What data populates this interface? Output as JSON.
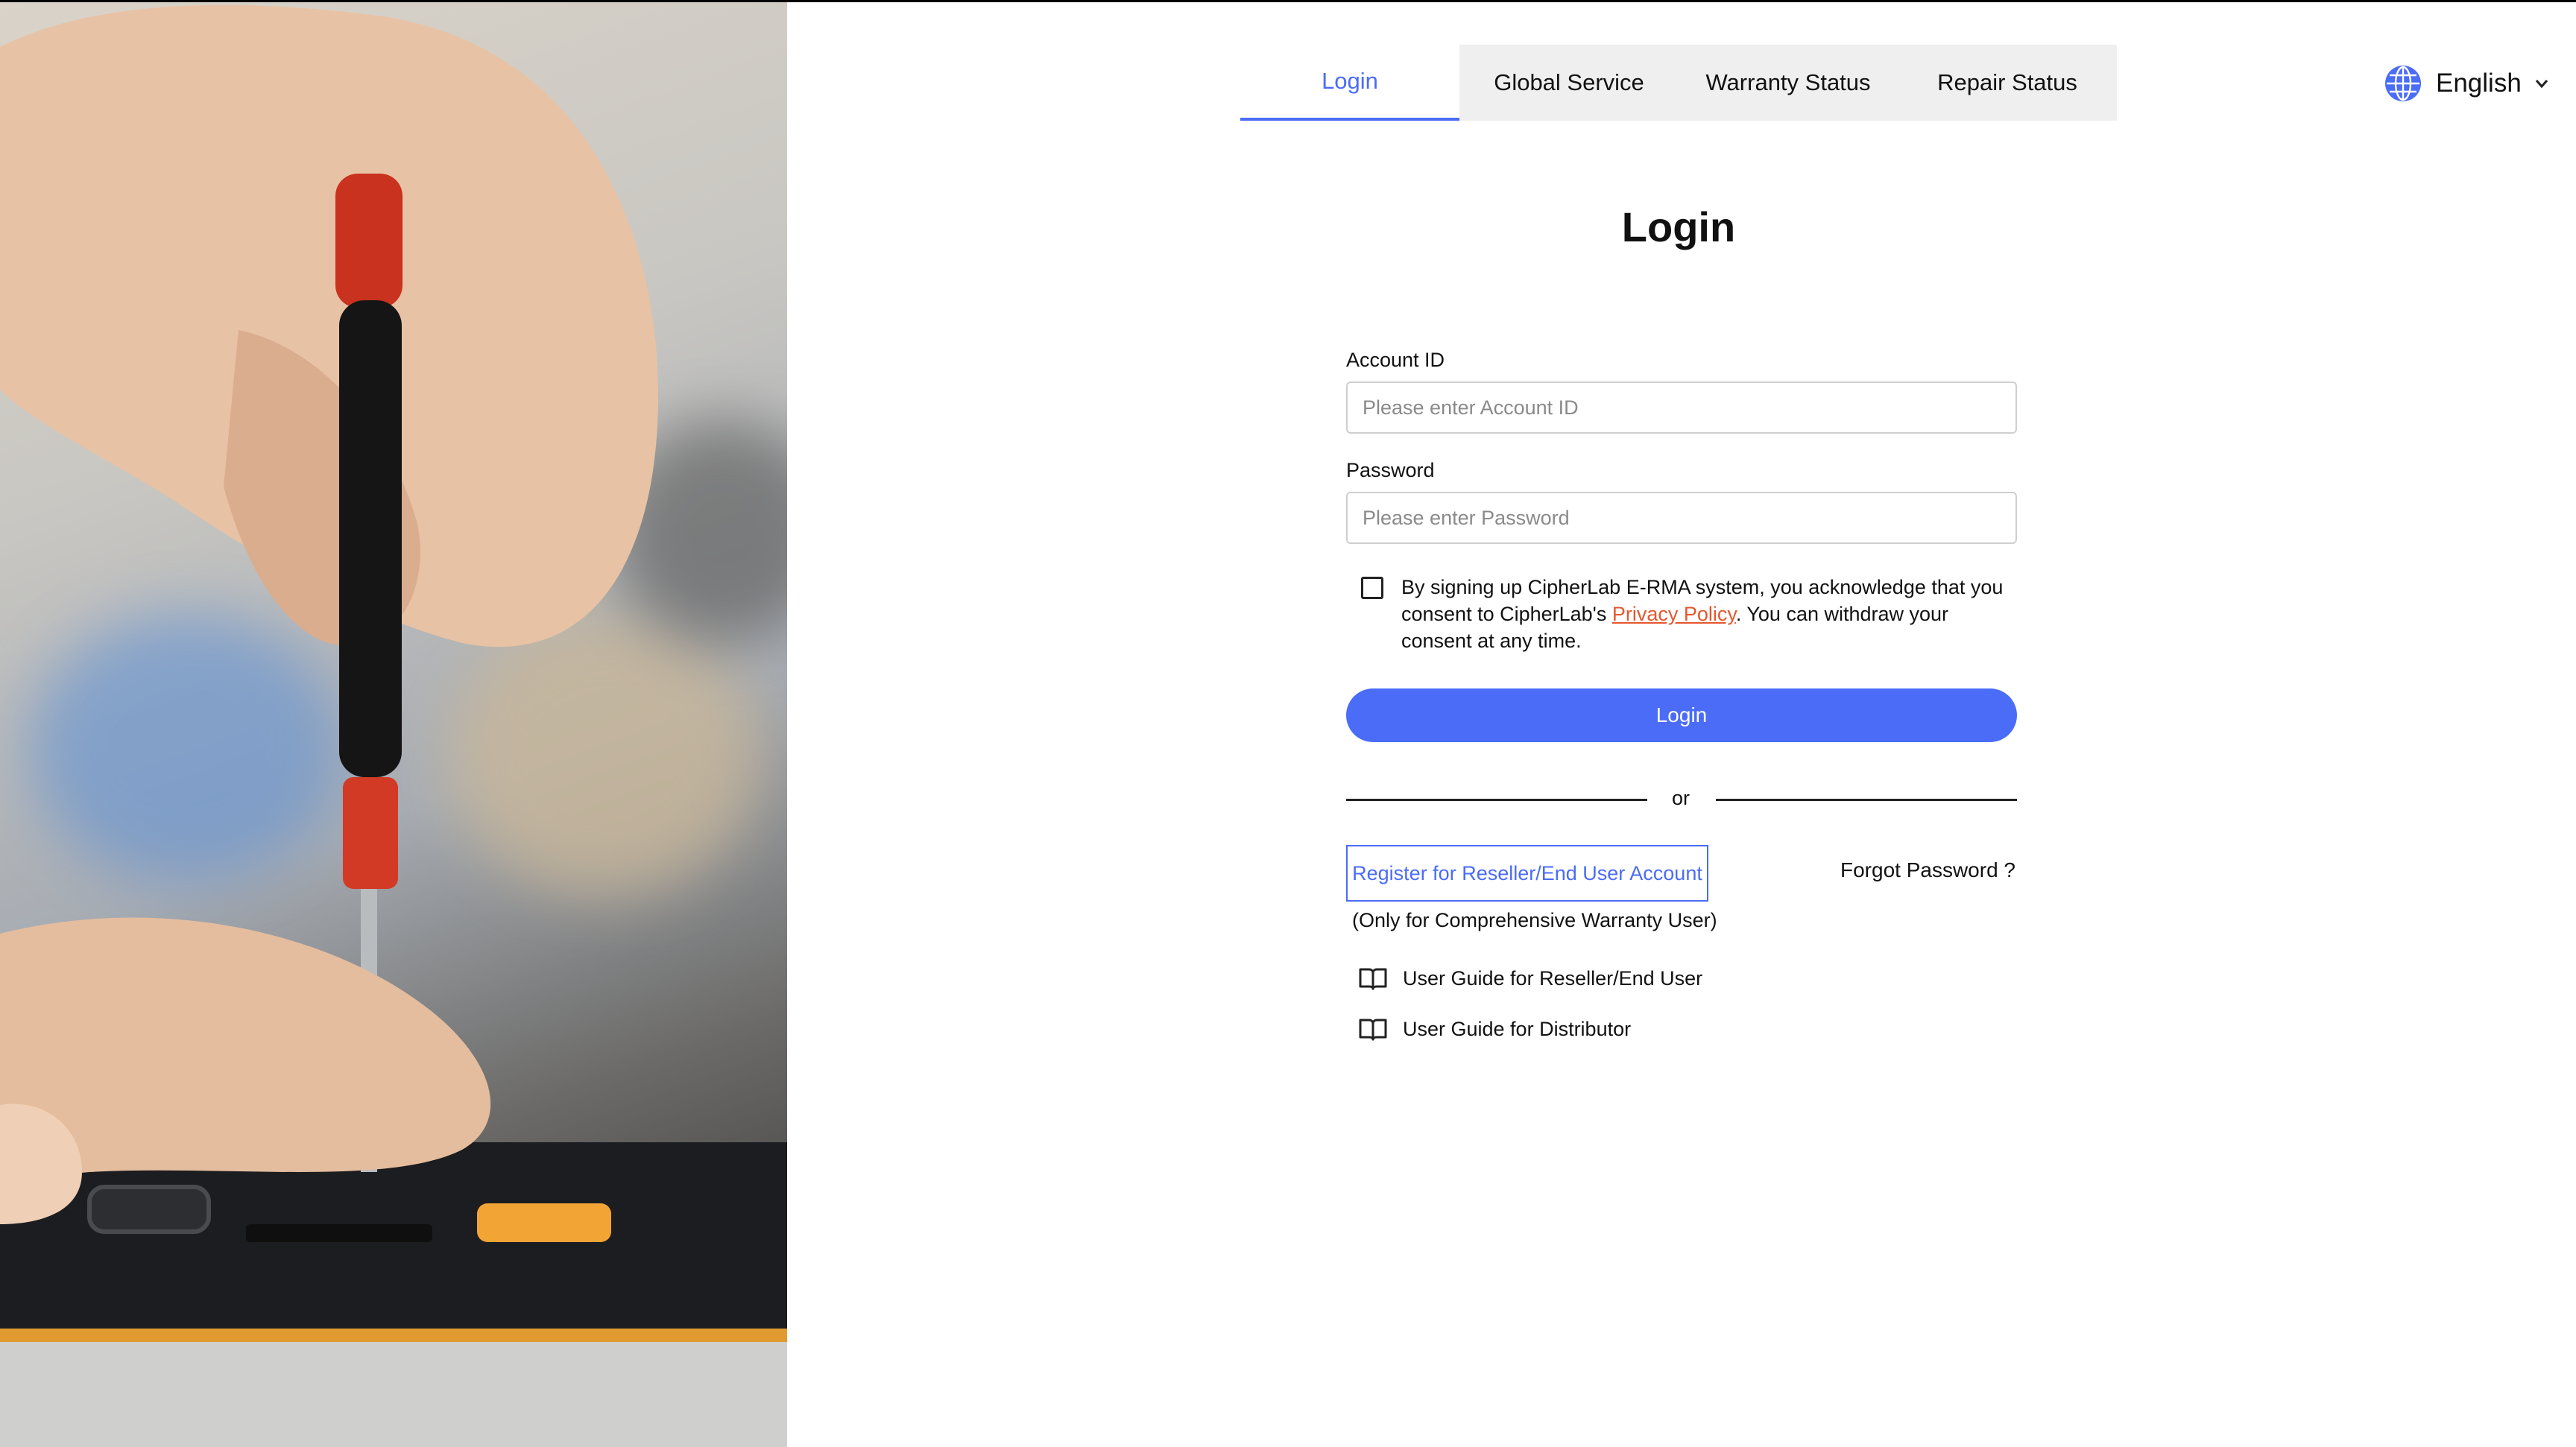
{
  "tabs": [
    {
      "label": "Login",
      "active": true
    },
    {
      "label": "Global Service",
      "active": false
    },
    {
      "label": "Warranty Status",
      "active": false
    },
    {
      "label": "Repair Status",
      "active": false
    }
  ],
  "language": {
    "label": "English",
    "icon": "globe-icon"
  },
  "form": {
    "title": "Login",
    "account_label": "Account ID",
    "account_placeholder": "Please enter Account ID",
    "account_value": "",
    "password_label": "Password",
    "password_placeholder": "Please enter Password",
    "password_value": "",
    "consent_checked": false,
    "consent_before": "By signing up CipherLab E-RMA system, you acknowledge that you consent to CipherLab's ",
    "consent_link": "Privacy Policy",
    "consent_after": ". You can withdraw your consent at any time.",
    "login_button": "Login",
    "or_text": "or",
    "register_button": "Register for Reseller/End User Account",
    "forgot_password": "Forgot Password ?",
    "register_note": "(Only for Comprehensive Warranty User)",
    "guides": [
      {
        "label": "User Guide for Reseller/End User",
        "icon": "book-icon"
      },
      {
        "label": "User Guide for Distributor",
        "icon": "book-icon"
      }
    ]
  },
  "colors": {
    "accent": "#4a6cf7",
    "link": "#e4572e",
    "tab_bg": "#efefef"
  }
}
